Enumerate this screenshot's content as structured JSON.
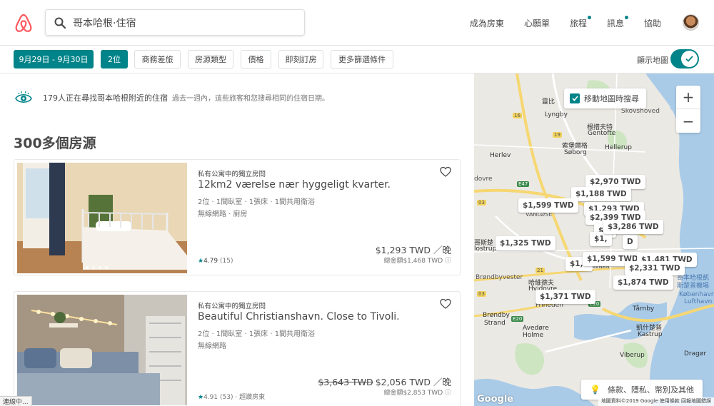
{
  "header": {
    "search_value": "哥本哈根·住宿",
    "nav": [
      {
        "label": "成為房東",
        "dot": false
      },
      {
        "label": "心願單",
        "dot": false
      },
      {
        "label": "旅程",
        "dot": true
      },
      {
        "label": "訊息",
        "dot": true
      },
      {
        "label": "協助",
        "dot": false
      }
    ]
  },
  "filters": {
    "dates": "9月29日 - 9月30日",
    "guests": "2位",
    "business": "商務差旅",
    "type": "房源類型",
    "price": "價格",
    "instant": "即刻訂房",
    "more": "更多篩選條件",
    "show_map": "顯示地圖",
    "show_map_on": true
  },
  "info": {
    "main": "179人正在尋找哥本哈根附近的住宿",
    "sub": "過去一週內，這些旅客和您搜尋相同的住宿日期。"
  },
  "results_count": "300多個房源",
  "listings": [
    {
      "type": "私有公寓中的獨立房間",
      "title": "12km2 værelse nær hyggeligt kvarter.",
      "specs": "2位 · 1間臥室 · 1張床 · 1間共用衛浴",
      "amenities": "無線網路 · 廚房",
      "rating": "4.79",
      "reviews": "(15)",
      "old_price": "",
      "price": "$1,293 TWD ／晚",
      "total": "總金額$1,468 TWD ⓘ",
      "badge": ""
    },
    {
      "type": "私有公寓中的獨立房間",
      "title": "Beautiful Christianshavn. Close to Tivoli.",
      "specs": "2位 · 1間臥室 · 1張床 · 1間共用衛浴",
      "amenities": "無線網路",
      "rating": "4.91",
      "reviews": "(53)",
      "old_price": "$3,643 TWD",
      "price": "$2,056 TWD ／晚",
      "total": "總金額$2,853 TWD ⓘ",
      "badge": "超讚房東"
    }
  ],
  "status_text": "連線中...",
  "map": {
    "search_as_move": "移動地圖時搜尋",
    "zoom_in": "+",
    "zoom_out": "−",
    "legal": "條款、隱私、幣別及其他",
    "google": "Google",
    "attribution": "地圖資料©2019 Google   使用條款   回報地圖錯誤",
    "labels": {
      "lyngby": "Lyngby",
      "lyngby_zh": "靈比",
      "skovshoved": "Skovshoved",
      "gentofte_zh": "根措夫特",
      "gentofte": "Gentofte",
      "soborg_zh": "索堡爾格",
      "soborg": "Søborg",
      "hellerup": "Hellerup",
      "herlev": "Herlev",
      "vanlose": "VANLØSE",
      "sydhavnen": "SYDHAVNEN",
      "brondbyvester": "Brøndbyvester",
      "hvidovre_zh": "哈維德夫",
      "hvidovre": "Hvidovre",
      "friheden": "Friheden",
      "brondby_strand": "Brøndby\nStrand",
      "avedore": "Avedøre\nHolme",
      "tarnby": "Tårnby",
      "kastrup_zh": "凱什楚普",
      "kastrup": "Kastrup",
      "vibergp": "Viberup",
      "dragor": "Dragør",
      "airport_zh": "哥本哈根凱斯楚普機場",
      "airport": "København\nLufthavn",
      "glostrup_zh": "哥斯楚",
      "glostrup": "lostrup",
      "rodovre": "dovre"
    },
    "pins": [
      "$2,970 TWD",
      "$1,188 TWD",
      "$1,599 TWD",
      "$1,293 TWD",
      "$2,399 TWD",
      "$3,286 TWD",
      "$1,325 TWD",
      "$1,599 TWD",
      "$1,481 TWD",
      "$2,331 TWD",
      "$1,874 TWD",
      "$1,371 TWD",
      "$1,8",
      "$3,",
      "$1,",
      "D"
    ]
  },
  "colors": {
    "accent": "#008489",
    "brand": "#ff5a5f",
    "text": "#484848",
    "muted": "#767676"
  }
}
